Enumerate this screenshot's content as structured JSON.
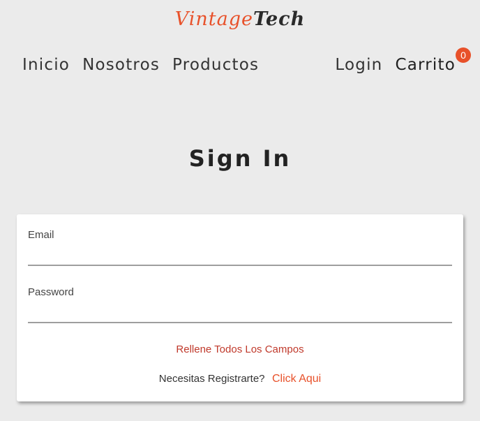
{
  "brand": {
    "part1": "Vintage",
    "part2": "Tech"
  },
  "nav": {
    "left": [
      "Inicio",
      "Nosotros",
      "Productos"
    ],
    "login": "Login",
    "cart": "Carrito",
    "cart_count": "0"
  },
  "page": {
    "title": "Sign In"
  },
  "form": {
    "email_label": "Email",
    "email_value": "",
    "password_label": "Password",
    "password_value": "",
    "error": "Rellene Todos Los Campos",
    "register_prompt": "Necesitas Registrarte?",
    "register_link": "Click Aqui"
  },
  "colors": {
    "accent": "#e8512a",
    "error": "#c0392b",
    "background": "#ebebeb"
  }
}
